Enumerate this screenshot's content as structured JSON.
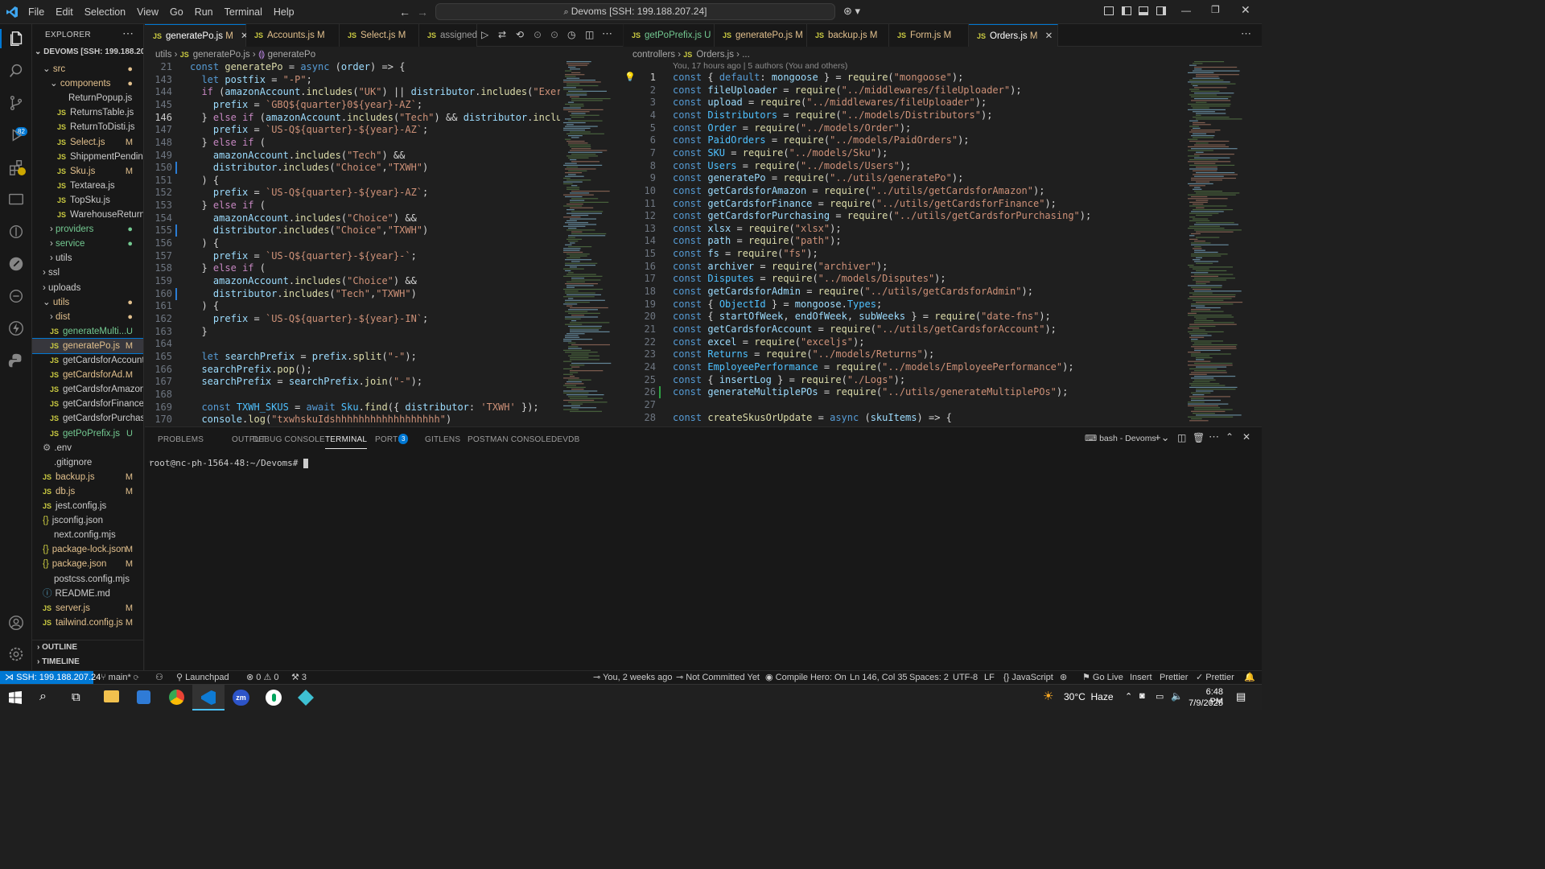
{
  "menu": [
    "File",
    "Edit",
    "Selection",
    "View",
    "Go",
    "Run",
    "Terminal",
    "Help"
  ],
  "command_center": "Devoms [SSH: 199.188.207.24]",
  "explorer": {
    "header": "EXPLORER",
    "root": "DEVOMS [SSH: 199.188.20...",
    "items": [
      {
        "label": "src",
        "indent": 1,
        "kind": "folder-open",
        "badge": "●",
        "badge_class": "mod"
      },
      {
        "label": "components",
        "indent": 2,
        "kind": "folder-open",
        "badge": "●",
        "badge_class": "mod"
      },
      {
        "label": "ReturnPopup.js",
        "indent": 3,
        "kind": "file",
        "badge": ""
      },
      {
        "label": "ReturnsTable.js",
        "indent": 3,
        "kind": "js",
        "badge": ""
      },
      {
        "label": "ReturnToDisti.js",
        "indent": 3,
        "kind": "js",
        "badge": ""
      },
      {
        "label": "Select.js",
        "indent": 3,
        "kind": "js",
        "badge": "M",
        "badge_class": "mod"
      },
      {
        "label": "ShippmentPending...",
        "indent": 3,
        "kind": "js",
        "badge": ""
      },
      {
        "label": "Sku.js",
        "indent": 3,
        "kind": "js",
        "badge": "M",
        "badge_class": "mod"
      },
      {
        "label": "Textarea.js",
        "indent": 3,
        "kind": "js",
        "badge": ""
      },
      {
        "label": "TopSku.js",
        "indent": 3,
        "kind": "js",
        "badge": ""
      },
      {
        "label": "WarehouseReturn.js",
        "indent": 3,
        "kind": "js",
        "badge": ""
      },
      {
        "label": "providers",
        "indent": 2,
        "kind": "folder",
        "badge": "●",
        "badge_class": "unt"
      },
      {
        "label": "service",
        "indent": 2,
        "kind": "folder",
        "badge": "●",
        "badge_class": "unt"
      },
      {
        "label": "utils",
        "indent": 2,
        "kind": "folder",
        "badge": ""
      },
      {
        "label": "ssl",
        "indent": 1,
        "kind": "folder",
        "badge": ""
      },
      {
        "label": "uploads",
        "indent": 1,
        "kind": "folder",
        "badge": ""
      },
      {
        "label": "utils",
        "indent": 1,
        "kind": "folder-open",
        "badge": "●",
        "badge_class": "mod"
      },
      {
        "label": "dist",
        "indent": 2,
        "kind": "folder",
        "badge": "●",
        "badge_class": "mod"
      },
      {
        "label": "generateMulti...",
        "indent": 2,
        "kind": "js",
        "badge": "U",
        "badge_class": "unt"
      },
      {
        "label": "generatePo.js",
        "indent": 2,
        "kind": "js",
        "badge": "M",
        "badge_class": "mod",
        "selected": true
      },
      {
        "label": "getCardsforAccount.js",
        "indent": 2,
        "kind": "js",
        "badge": ""
      },
      {
        "label": "getCardsforAd...",
        "indent": 2,
        "kind": "js",
        "badge": "M",
        "badge_class": "mod"
      },
      {
        "label": "getCardsforAmazon.js",
        "indent": 2,
        "kind": "js",
        "badge": ""
      },
      {
        "label": "getCardsforFinance.js",
        "indent": 2,
        "kind": "js",
        "badge": ""
      },
      {
        "label": "getCardsforPurchasi...",
        "indent": 2,
        "kind": "js",
        "badge": ""
      },
      {
        "label": "getPoPrefix.js",
        "indent": 2,
        "kind": "js",
        "badge": "U",
        "badge_class": "unt"
      },
      {
        "label": ".env",
        "indent": 1,
        "kind": "gear",
        "badge": ""
      },
      {
        "label": ".gitignore",
        "indent": 1,
        "kind": "plain",
        "badge": ""
      },
      {
        "label": "backup.js",
        "indent": 1,
        "kind": "js",
        "badge": "M",
        "badge_class": "mod"
      },
      {
        "label": "db.js",
        "indent": 1,
        "kind": "js",
        "badge": "M",
        "badge_class": "mod"
      },
      {
        "label": "jest.config.js",
        "indent": 1,
        "kind": "js",
        "badge": ""
      },
      {
        "label": "jsconfig.json",
        "indent": 1,
        "kind": "json",
        "badge": ""
      },
      {
        "label": "next.config.mjs",
        "indent": 1,
        "kind": "plain",
        "badge": ""
      },
      {
        "label": "package-lock.json",
        "indent": 1,
        "kind": "json",
        "badge": "M",
        "badge_class": "mod"
      },
      {
        "label": "package.json",
        "indent": 1,
        "kind": "json",
        "badge": "M",
        "badge_class": "mod"
      },
      {
        "label": "postcss.config.mjs",
        "indent": 1,
        "kind": "plain",
        "badge": ""
      },
      {
        "label": "README.md",
        "indent": 1,
        "kind": "info",
        "badge": ""
      },
      {
        "label": "server.js",
        "indent": 1,
        "kind": "js",
        "badge": "M",
        "badge_class": "mod"
      },
      {
        "label": "tailwind.config.js",
        "indent": 1,
        "kind": "js",
        "badge": "M",
        "badge_class": "mod"
      }
    ],
    "outline": "OUTLINE",
    "timeline": "TIMELINE"
  },
  "left_tabs": [
    {
      "label": "generatePo.js",
      "status": "M",
      "active": true
    },
    {
      "label": "Accounts.js",
      "status": "M"
    },
    {
      "label": "Select.js",
      "status": "M"
    },
    {
      "label": "assigned"
    }
  ],
  "right_tabs": [
    {
      "label": "getPoPrefix.js",
      "status": "U"
    },
    {
      "label": "generatePo.js",
      "status": "M"
    },
    {
      "label": "backup.js",
      "status": "M"
    },
    {
      "label": "Form.js",
      "status": "M"
    },
    {
      "label": "Orders.js",
      "status": "M",
      "active": true
    }
  ],
  "left_breadcrumb": [
    "utils",
    "generatePo.js",
    "generatePo"
  ],
  "left_sticky": {
    "num": "21",
    "code": "const generatePo = async (order) => {"
  },
  "left_code": [
    {
      "n": "143",
      "t": "  let postfix = \"-P\";"
    },
    {
      "n": "144",
      "t": "  if (amazonAccount.includes(\"UK\") || distributor.includes(\"Exertis\")) {"
    },
    {
      "n": "145",
      "t": "    prefix = `GBQ${quarter}0${year}-AZ`;"
    },
    {
      "n": "146",
      "t": "  } else if (amazonAccount.includes(\"Tech\") && distributor.includes(\"Tec"
    },
    {
      "n": "147",
      "t": "    prefix = `US-Q${quarter}-${year}-AZ`;"
    },
    {
      "n": "148",
      "t": "  } else if ("
    },
    {
      "n": "149",
      "t": "    amazonAccount.includes(\"Tech\") &&"
    },
    {
      "n": "150",
      "t": "    distributor.includes(\"Choice\",\"TXWH\")"
    },
    {
      "n": "151",
      "t": "  ) {"
    },
    {
      "n": "152",
      "t": "    prefix = `US-Q${quarter}-${year}-AZ`;"
    },
    {
      "n": "153",
      "t": "  } else if ("
    },
    {
      "n": "154",
      "t": "    amazonAccount.includes(\"Choice\") &&"
    },
    {
      "n": "155",
      "t": "    distributor.includes(\"Choice\",\"TXWH\")"
    },
    {
      "n": "156",
      "t": "  ) {"
    },
    {
      "n": "157",
      "t": "    prefix = `US-Q${quarter}-${year}-`;"
    },
    {
      "n": "158",
      "t": "  } else if ("
    },
    {
      "n": "159",
      "t": "    amazonAccount.includes(\"Choice\") &&"
    },
    {
      "n": "160",
      "t": "    distributor.includes(\"Tech\",\"TXWH\")"
    },
    {
      "n": "161",
      "t": "  ) {"
    },
    {
      "n": "162",
      "t": "    prefix = `US-Q${quarter}-${year}-IN`;"
    },
    {
      "n": "163",
      "t": "  }"
    },
    {
      "n": "164",
      "t": ""
    },
    {
      "n": "165",
      "t": "  let searchPrefix = prefix.split(\"-\");"
    },
    {
      "n": "166",
      "t": "  searchPrefix.pop();"
    },
    {
      "n": "167",
      "t": "  searchPrefix = searchPrefix.join(\"-\");"
    },
    {
      "n": "168",
      "t": ""
    },
    {
      "n": "169",
      "t": "  const TXWH_SKUS = await Sku.find({ distributor: 'TXWH' });"
    },
    {
      "n": "170",
      "t": "  console.log(\"txwhskuIdshhhhhhhhhhhhhhhhhh\")"
    }
  ],
  "right_breadcrumb": [
    "controllers",
    "Orders.js",
    "..."
  ],
  "blame": "You, 17 hours ago | 5 authors (You and others)",
  "right_code": [
    {
      "n": "1",
      "t": "const { default: mongoose } = require(\"mongoose\");"
    },
    {
      "n": "2",
      "t": "const fileUploader = require(\"../middlewares/fileUploader\");"
    },
    {
      "n": "3",
      "t": "const upload = require(\"../middlewares/fileUploader\");"
    },
    {
      "n": "4",
      "t": "const Distributors = require(\"../models/Distributors\");"
    },
    {
      "n": "5",
      "t": "const Order = require(\"../models/Order\");"
    },
    {
      "n": "6",
      "t": "const PaidOrders = require(\"../models/PaidOrders\");"
    },
    {
      "n": "7",
      "t": "const SKU = require(\"../models/Sku\");"
    },
    {
      "n": "8",
      "t": "const Users = require(\"../models/Users\");"
    },
    {
      "n": "9",
      "t": "const generatePo = require(\"../utils/generatePo\");"
    },
    {
      "n": "10",
      "t": "const getCardsforAmazon = require(\"../utils/getCardsforAmazon\");"
    },
    {
      "n": "11",
      "t": "const getCardsforFinance = require(\"../utils/getCardsforFinance\");"
    },
    {
      "n": "12",
      "t": "const getCardsforPurchasing = require(\"../utils/getCardsforPurchasing\");"
    },
    {
      "n": "13",
      "t": "const xlsx = require(\"xlsx\");"
    },
    {
      "n": "14",
      "t": "const path = require(\"path\");"
    },
    {
      "n": "15",
      "t": "const fs = require(\"fs\");"
    },
    {
      "n": "16",
      "t": "const archiver = require(\"archiver\");"
    },
    {
      "n": "17",
      "t": "const Disputes = require(\"../models/Disputes\");"
    },
    {
      "n": "18",
      "t": "const getCardsforAdmin = require(\"../utils/getCardsforAdmin\");"
    },
    {
      "n": "19",
      "t": "const { ObjectId } = mongoose.Types;"
    },
    {
      "n": "20",
      "t": "const { startOfWeek, endOfWeek, subWeeks } = require(\"date-fns\");"
    },
    {
      "n": "21",
      "t": "const getCardsforAccount = require(\"../utils/getCardsforAccount\");"
    },
    {
      "n": "22",
      "t": "const excel = require(\"exceljs\");"
    },
    {
      "n": "23",
      "t": "const Returns = require(\"../models/Returns\");"
    },
    {
      "n": "24",
      "t": "const EmployeePerformance = require(\"../models/EmployeePerformance\");"
    },
    {
      "n": "25",
      "t": "const { insertLog } = require(\"./Logs\");"
    },
    {
      "n": "26",
      "t": "const generateMultiplePOs = require(\"../utils/generateMultiplePOs\");"
    },
    {
      "n": "27",
      "t": ""
    },
    {
      "n": "28",
      "t": "const createSkusOrUpdate = async (skuItems) => {"
    }
  ],
  "panel": {
    "tabs": [
      "PROBLEMS",
      "OUTPUT",
      "DEBUG CONSOLE",
      "TERMINAL",
      "PORTS",
      "GITLENS",
      "POSTMAN CONSOLE",
      "DEVDB"
    ],
    "ports_count": "3",
    "terminal_name": "bash - Devoms",
    "prompt": "root@nc-ph-1564-48:~/Devoms# "
  },
  "status": {
    "remote": "SSH: 199.188.207.24",
    "branch": "main*",
    "launchpad": "Launchpad",
    "errors": "0",
    "warnings": "0",
    "ports": "3",
    "blame": "You, 2 weeks ago",
    "commit": "Not Committed Yet",
    "compile_hero": "Compile Hero: On",
    "cursor": "Ln 146, Col 35",
    "spaces": "Spaces: 2",
    "encoding": "UTF-8",
    "eol": "LF",
    "language": "JavaScript",
    "golive": "Go Live",
    "insert": "Insert",
    "prettier1": "Prettier",
    "prettier2": "Prettier"
  },
  "taskbar": {
    "weather": "30°C  Haze",
    "time": "6:48 PM",
    "date": "7/9/2025"
  },
  "colors": {
    "accent": "#0078d4",
    "remote": "#0078d4",
    "modified": "#e2c08d",
    "untracked": "#73c991"
  }
}
